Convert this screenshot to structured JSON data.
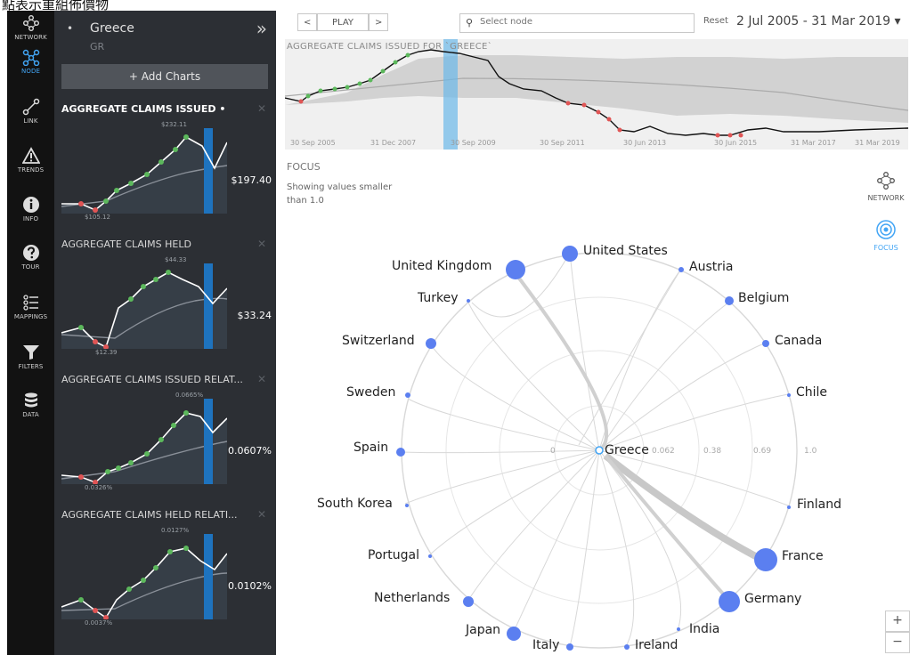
{
  "caption_fragment": "點表示重組佈價物",
  "rail": [
    {
      "key": "network",
      "label": "NETWORK",
      "icon": "network-icon",
      "active": false
    },
    {
      "key": "node",
      "label": "NODE",
      "icon": "node-icon",
      "active": true
    },
    {
      "key": "link",
      "label": "LINK",
      "icon": "link-icon",
      "active": false
    },
    {
      "key": "trends",
      "label": "TRENDS",
      "icon": "warning-triangle-icon",
      "active": false
    },
    {
      "key": "info",
      "label": "INFO",
      "icon": "info-icon",
      "active": false
    },
    {
      "key": "tour",
      "label": "TOUR",
      "icon": "help-icon",
      "active": false
    },
    {
      "key": "mappings",
      "label": "MAPPINGS",
      "icon": "mappings-icon",
      "active": false
    },
    {
      "key": "filters",
      "label": "FILTERS",
      "icon": "filter-icon",
      "active": false
    },
    {
      "key": "data",
      "label": "DATA",
      "icon": "database-icon",
      "active": false
    }
  ],
  "panel": {
    "country": "Greece",
    "code": "GR",
    "collapse_icon": "double-chevron-right-icon",
    "add_charts": "+ Add Charts",
    "charts": [
      {
        "title": "AGGREGATE CLAIMS ISSUED",
        "dot": "•",
        "value": "$197.40",
        "max": "$232.11",
        "min": "$105.12"
      },
      {
        "title": "AGGREGATE CLAIMS HELD",
        "dot": "",
        "value": "$33.24",
        "max": "$44.33",
        "min": "$12.39"
      },
      {
        "title": "AGGREGATE CLAIMS ISSUED RELAT...",
        "dot": "",
        "value": "0.0607%",
        "max": "0.0665%",
        "min": "0.0326%"
      },
      {
        "title": "AGGREGATE CLAIMS HELD RELATI...",
        "dot": "",
        "value": "0.0102%",
        "max": "0.0127%",
        "min": "0.0037%"
      }
    ]
  },
  "toolbar": {
    "prev": "<",
    "play": "PLAY",
    "next": ">",
    "search_placeholder": "Select node",
    "reset": "Reset",
    "range": "2 Jul 2005 - 31 Mar 2019 ▾"
  },
  "timeline": {
    "title": "AGGREGATE CLAIMS ISSUED FOR `GREECE`",
    "ticks": [
      "30 Sep 2005",
      "31 Dec 2007",
      "30 Sep 2009",
      "30 Sep 2011",
      "30 Jun 2013",
      "30 Jun 2015",
      "31 Mar 2017",
      "31 Mar 2019"
    ]
  },
  "focus": {
    "title": "FOCUS",
    "desc": "Showing values smaller than 1.0"
  },
  "views": {
    "network_label": "NETWORK",
    "focus_label": "FOCUS"
  },
  "zoom": {
    "plus": "+",
    "minus": "−"
  },
  "radial": {
    "center": "Greece",
    "scale_labels": [
      "0",
      "0.062",
      "0.38",
      "0.69",
      "1.0"
    ],
    "nodes": [
      "United States",
      "Austria",
      "Belgium",
      "Canada",
      "Chile",
      "Finland",
      "France",
      "Germany",
      "India",
      "Ireland",
      "Italy",
      "Japan",
      "Netherlands",
      "Portugal",
      "South Korea",
      "Spain",
      "Sweden",
      "Switzerland",
      "Turkey",
      "United Kingdom"
    ]
  },
  "colors": {
    "accent": "#42a5f5",
    "node": "#5b7ff0",
    "panel": "#2c2f34",
    "rail": "#121212",
    "up": "#5cb85c",
    "down": "#e05555"
  }
}
